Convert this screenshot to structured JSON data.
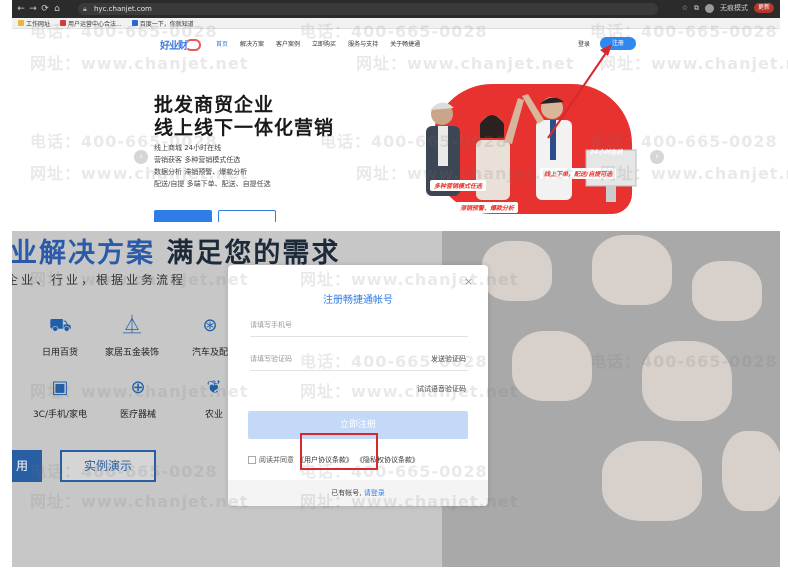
{
  "browser": {
    "url": "hyc.chanjet.com",
    "nav_icons": [
      "←",
      "→",
      "⟳",
      "⌂"
    ],
    "update_label": "更新",
    "profile_label": "无痕模式",
    "bookmarks": [
      {
        "label": "工作网址",
        "icon": "folder-icon"
      },
      {
        "label": "用户运营中心合法...",
        "icon": "bookmark-red-icon"
      },
      {
        "label": "百度一下，你就知道",
        "icon": "bookmark-blue-icon"
      }
    ]
  },
  "site": {
    "logo_text": "好业财",
    "nav": [
      "首页",
      "解决方案",
      "客户案例",
      "立即购买",
      "服务与支持",
      "关于畅捷通"
    ],
    "login_label": "登录",
    "register_label": "注册"
  },
  "hero": {
    "title_line1": "批发商贸企业",
    "title_line2": "线上线下一体化营销",
    "sub_lines": [
      "线上商城 24小时在线",
      "营销获客 多种营销模式任选",
      "数据分析 滞销预警、爆款分析",
      "配送/自提 多端下单、配送、自提任选"
    ],
    "tags": [
      "24小时在线",
      "线上下单，配送/自提可选",
      "多种营销模式任选",
      "滞销预警、爆款分析"
    ]
  },
  "section": {
    "title_blue": "业解决方案",
    "title_dark": "满足您的需求",
    "subtitle": "企业、行业，根据业务流程",
    "categories": [
      {
        "label": "日用百货",
        "icon": "basket-icon"
      },
      {
        "label": "家居五金装饰",
        "icon": "lamp-icon"
      },
      {
        "label": "汽车及配",
        "icon": "steering-wheel-icon"
      },
      {
        "label": "3C/手机/家电",
        "icon": "appliance-icon"
      },
      {
        "label": "医疗器械",
        "icon": "medical-kit-icon"
      },
      {
        "label": "农业",
        "icon": "plant-icon"
      }
    ],
    "btn_solid_label": "用",
    "btn_outline_label": "实例演示"
  },
  "modal": {
    "title": "注册畅捷通帐号",
    "close_glyph": "×",
    "phone_placeholder": "请填写手机号",
    "code_placeholder": "请填写验证码",
    "send_code_label": "发送验证码",
    "voice_code_label": "试试语音验证码",
    "submit_label": "立即注册",
    "agree_prefix": "阅读并同意",
    "agreement_link": "《用户协议条款》",
    "privacy_link": "《隐私权协议条款》",
    "footer_text": "已有帐号,",
    "footer_login_link": "请登录"
  },
  "watermark": {
    "phone": "电话：400-665-0028",
    "site": "网址：www.chanjet.net"
  },
  "colors": {
    "accent_blue": "#2f7de6",
    "annotation_red": "#d9282b",
    "hero_red": "#e8322f"
  }
}
